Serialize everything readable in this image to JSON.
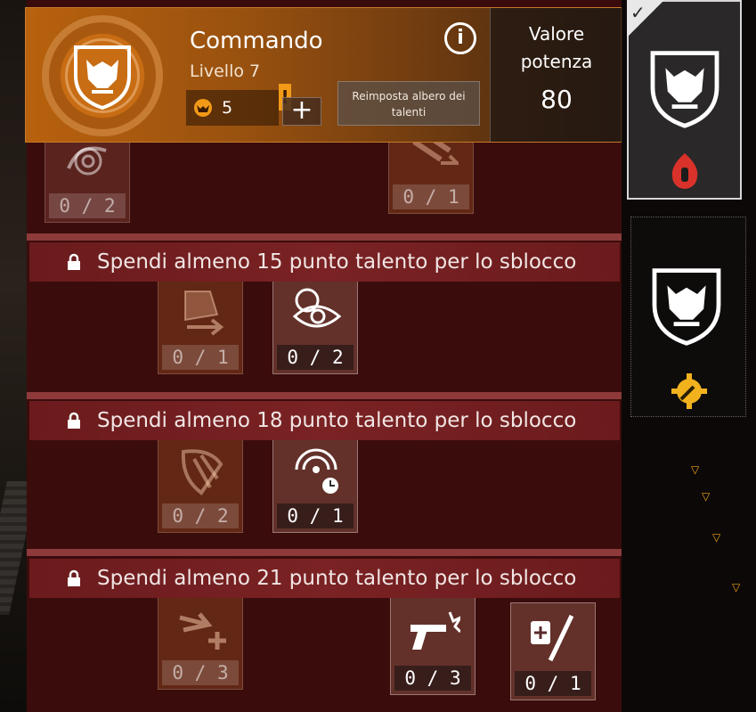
{
  "header": {
    "class_name": "Commando",
    "level": "Livello 7",
    "talent_points": "5",
    "alert": "!",
    "add_label": "+",
    "reset_label": "Reimposta albero dei talenti",
    "info_label": "i",
    "power_label": "Valore potenza",
    "power_value": "80"
  },
  "tiers": [
    {
      "talents": [
        {
          "rank": "0 / 2"
        },
        {
          "rank": "0 / 1"
        }
      ]
    },
    {
      "lock_text": "Spendi almeno 15 punto talento per lo sblocco",
      "talents": [
        {
          "rank": "0 / 1"
        },
        {
          "rank": "0 / 2"
        }
      ]
    },
    {
      "lock_text": "Spendi almeno 18 punto talento per lo sblocco",
      "talents": [
        {
          "rank": "0 / 2"
        },
        {
          "rank": "0 / 1"
        }
      ]
    },
    {
      "lock_text": "Spendi almeno 21 punto talento per lo sblocco",
      "talents": [
        {
          "rank": "0 / 3"
        },
        {
          "rank": "0 / 3"
        },
        {
          "rank": "0 / 1"
        }
      ]
    }
  ],
  "specializations": [
    {
      "icon": "wolf-emblem-icon",
      "badge": "flame-bullet-icon",
      "selected": true
    },
    {
      "icon": "wolf-emblem-icon",
      "badge": "gear-wrench-icon",
      "selected": false
    }
  ],
  "colors": {
    "accent": "#b8610e",
    "panel": "#3a0b0b",
    "banner": "#7a2224"
  }
}
